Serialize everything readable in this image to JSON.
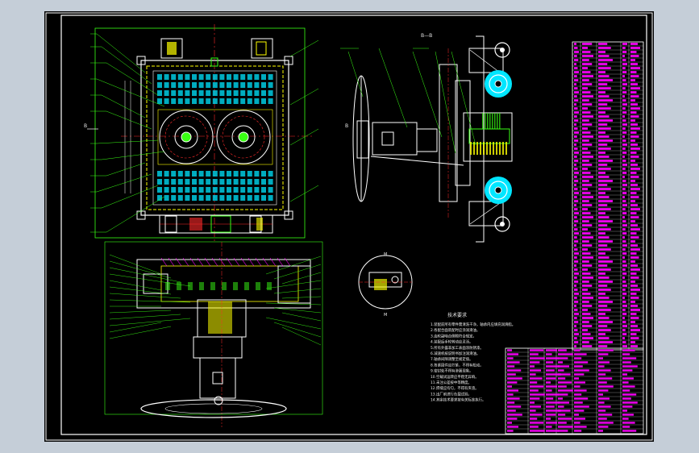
{
  "drawing": {
    "background": "#000000",
    "viewport_color": "#c5ced8",
    "colors": {
      "outline": "#ffffff",
      "green": "#39ff14",
      "yellow": "#ffff00",
      "red": "#ff2a2a",
      "cyan": "#00e6ff",
      "magenta": "#ff00ff"
    },
    "section_label": "B—B",
    "view_mark": "B",
    "detail_label": "M",
    "tech_title": "技术要求",
    "tech_notes": [
      "1.装配前所有零件需清洗干净，轴承内应填充润滑脂。",
      "2.各配合面装配时应涂润滑油。",
      "3.齿轮副啮合侧隙符合规定。",
      "4.装配后手轮转动应灵活。",
      "5.所有外露非加工表面涂防锈漆。",
      "6.减速机按说明书加注润滑油。",
      "7.轴承间隙调整至规定值。",
      "8.各紧固件应拧紧，不得有松动。",
      "9.密封处不得有渗漏现象。",
      "10.空载试运转应平稳无异响。",
      "11.未注公差按中等精度。",
      "12.焊缝应均匀，不得有夹渣。",
      "13.出厂前进行负载试验。",
      "14.其余技术要求按有关标准执行。"
    ]
  }
}
